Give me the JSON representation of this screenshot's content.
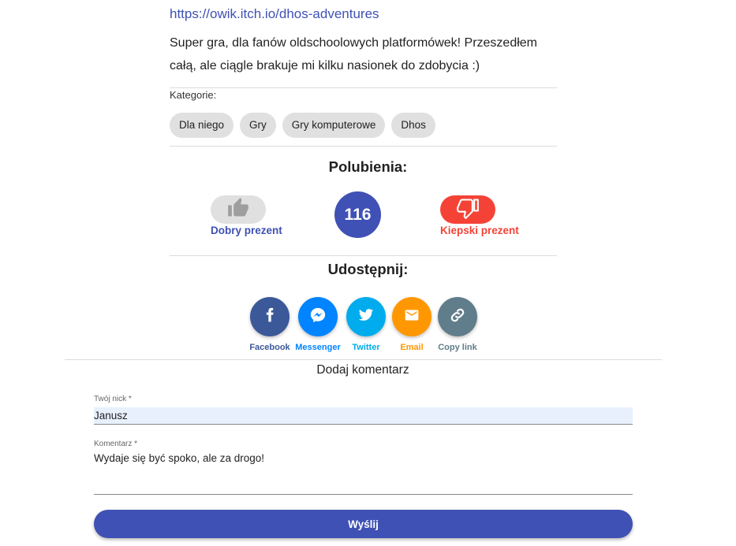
{
  "post": {
    "link": "https://owik.itch.io/dhos-adventures",
    "description": "Super gra, dla fanów oldschoolowych platformówek! Przeszedłem całą, ale ciągle brakuje mi kilku nasionek do zdobycia :)"
  },
  "categories": {
    "label": "Kategorie:",
    "items": [
      "Dla niego",
      "Gry",
      "Gry komputerowe",
      "Dhos"
    ]
  },
  "likes": {
    "title": "Polubienia:",
    "good_label": "Dobry prezent",
    "bad_label": "Kiepski prezent",
    "count": "116",
    "good_icon": "thumbs-up-icon",
    "bad_icon": "thumbs-down-icon"
  },
  "share": {
    "title": "Udostępnij:",
    "items": [
      {
        "label": "Facebook",
        "icon": "facebook-icon",
        "color": "#3b5998"
      },
      {
        "label": "Messenger",
        "icon": "messenger-icon",
        "color": "#0084ff"
      },
      {
        "label": "Twitter",
        "icon": "twitter-icon",
        "color": "#00aced"
      },
      {
        "label": "Email",
        "icon": "email-icon",
        "color": "#ff9800"
      },
      {
        "label": "Copy link",
        "icon": "link-icon",
        "color": "#607d8b"
      }
    ]
  },
  "comment_form": {
    "title": "Dodaj komentarz",
    "nick_label": "Twój nick *",
    "nick_value": "Janusz",
    "comment_label": "Komentarz *",
    "comment_value": "Wydaje się być spoko, ale za drogo!",
    "submit_label": "Wyślij"
  },
  "colors": {
    "primary": "#3f51b5",
    "danger": "#f44336",
    "chip_bg": "#e0e0e0"
  }
}
